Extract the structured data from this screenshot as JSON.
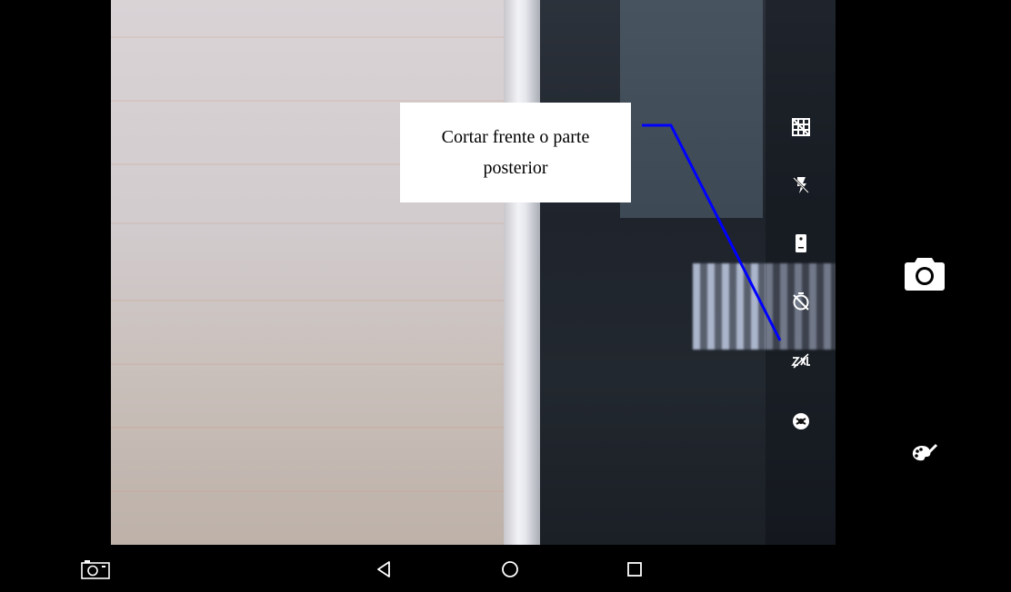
{
  "viewfinder": {
    "description_free": true
  },
  "settings_icons": [
    {
      "name": "grid-icon"
    },
    {
      "name": "flash-off-icon"
    },
    {
      "name": "switch-camera-icon"
    },
    {
      "name": "timer-off-icon"
    },
    {
      "name": "hdr-off-icon"
    },
    {
      "name": "scene-mode-icon"
    }
  ],
  "controls": {
    "shutter_icon": "camera-icon",
    "effects_icon": "palette-icon"
  },
  "navbar": {
    "screenshot_icon": "camera-outline-icon",
    "back_icon": "back-triangle-icon",
    "home_icon": "home-circle-icon",
    "recents_icon": "recents-square-icon"
  },
  "callout": {
    "text": "Cortar frente o parte posterior",
    "line_color": "#0000ff"
  }
}
